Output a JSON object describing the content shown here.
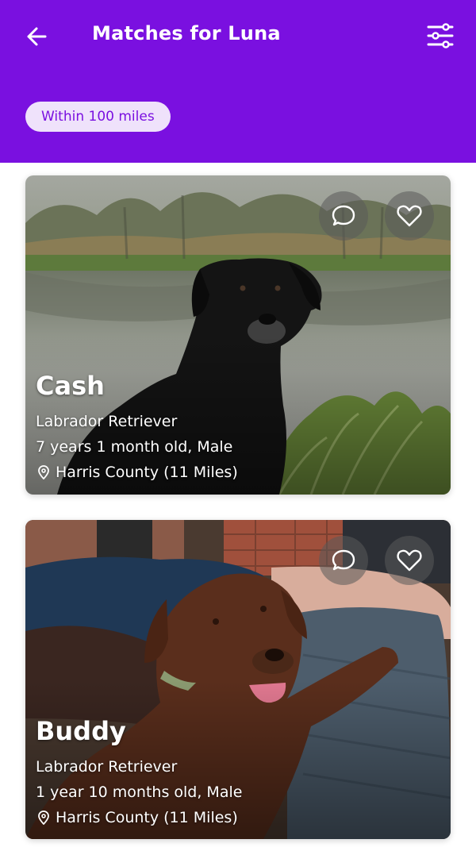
{
  "theme": {
    "brand": "#7a10e0",
    "chip_bg": "#efe2fb"
  },
  "header": {
    "title": "Matches for Luna",
    "back_icon": "arrow-left-icon",
    "filter_icon": "sliders-icon",
    "distance_chip": "Within 100 miles"
  },
  "matches": [
    {
      "name": "Cash",
      "breed": "Labrador Retriever",
      "age_sex": "7 years 1 month old, Male",
      "location": "Harris County (11 Miles)",
      "photo": "black labrador sitting by a pond"
    },
    {
      "name": "Buddy",
      "breed": "Labrador Retriever",
      "age_sex": "1 year 10 months old, Male",
      "location": "Harris County (11 Miles)",
      "photo": "chocolate labrador lying on a couch"
    }
  ]
}
